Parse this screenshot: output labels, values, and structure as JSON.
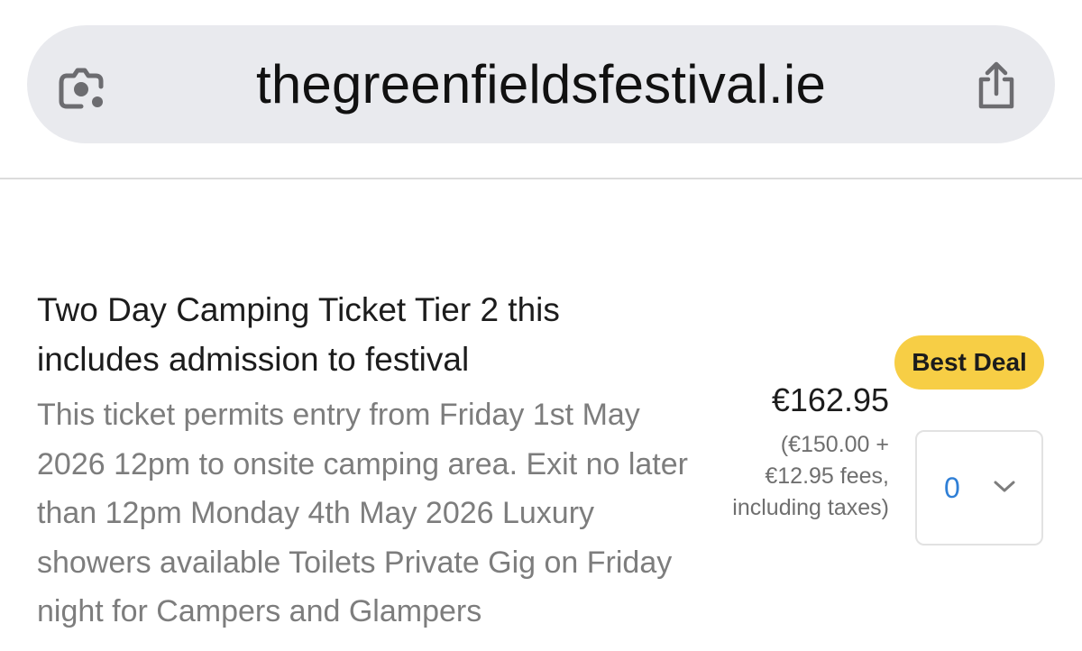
{
  "browser": {
    "url": "thegreenfieldsfestival.ie",
    "lens_icon": "lens-camera-icon",
    "share_icon": "share-icon"
  },
  "ticket": {
    "title": "Two Day Camping Ticket Tier 2 this includes admission to festival",
    "description": "This ticket permits entry from Friday 1st May 2026 12pm to onsite camping area. Exit no later than 12pm Monday 4th May 2026 Luxury showers available Toilets Private Gig on Friday night for Campers and Glampers",
    "badge": "Best Deal",
    "price": "€162.95",
    "price_breakdown": "(€150.00 + €12.95 fees, including taxes)",
    "quantity": "0",
    "quantity_icon": "chevron-down-icon"
  },
  "colors": {
    "badge_bg": "#f7ce45",
    "quantity_text": "#2f7fd6",
    "address_bar_bg": "#e9eaee"
  }
}
